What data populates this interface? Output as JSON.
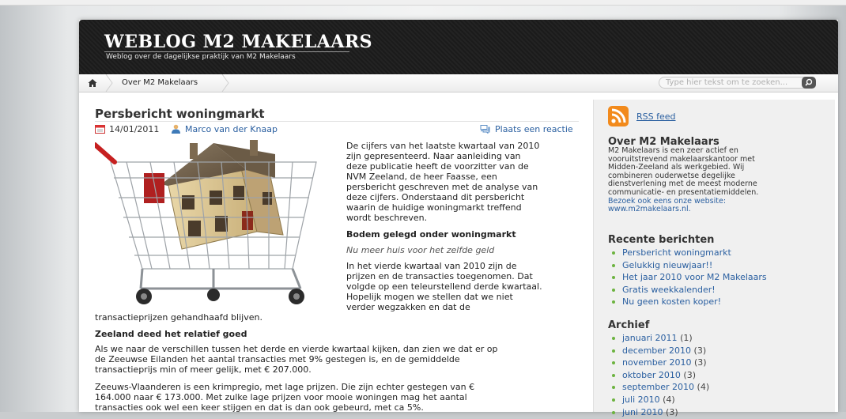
{
  "header": {
    "site_title": "WEBLOG M2 MAKELAARS",
    "site_description": "Weblog over de dagelijkse praktijk van M2 Makelaars"
  },
  "nav": {
    "items": [
      "Over M2 Makelaars"
    ],
    "search_placeholder": "Type hier tekst om te zoeken..."
  },
  "post": {
    "title": "Persbericht woningmarkt",
    "date": "14/01/2011",
    "author": "Marco van der Knaap",
    "comment_link": "Plaats een reactie",
    "intro_lines": [
      "De cijfers van het laatste kwartaal van 2010",
      "zijn gepresenteerd. Naar aanleiding van",
      "deze publicatie heeft de voorzitter van de",
      "NVM Zeeland, de heer Faasse, een",
      "persbericht geschreven met de analyse van",
      "deze cijfers. Onderstaand dit persbericht",
      "waarin de huidige woningmarkt treffend",
      "wordt beschreven."
    ],
    "subheading": "Bodem gelegd onder woningmarkt",
    "tagline": "Nu meer huis voor het zelfde geld",
    "q4_lines": [
      "In het vierde kwartaal van 2010 zijn de",
      "prijzen en de transacties toegenomen. Dat",
      "volgde op een teleurstellend derde kwartaal.",
      "Hopelijk mogen we stellen dat we niet",
      "verder wegzakken en dat de"
    ],
    "q4_tail": "transactieprijzen gehandhaafd blijven.",
    "section2_heading": "Zeeland deed het relatief goed",
    "section2_lines": [
      "Als we naar de verschillen tussen het derde en vierde kwartaal kijken, dan zien we dat er op",
      "de Zeeuwse Eilanden het aantal transacties met 9% gestegen is, en de gemiddelde",
      "transactieprijs min of meer gelijk, met € 207.000."
    ],
    "section3_lines": [
      "Zeeuws-Vlaanderen is een krimpregio, met lage prijzen. Die zijn echter gestegen van €",
      "164.000 naar € 173.000. Met zulke lage prijzen voor mooie woningen mag het aantal",
      "transacties ook wel een keer stijgen en dat is dan ook gebeurd, met ca 5%."
    ]
  },
  "sidebar": {
    "rss_label": "RSS feed",
    "about": {
      "heading": "Over M2 Makelaars",
      "lines": [
        "M2 Makelaars is een zeer actief en",
        "vooruitstrevend makelaarskantoor met",
        "Midden-Zeeland als werkgebied. Wij",
        "combineren ouderwetse degelijke",
        "dienstverlening met de meest moderne",
        "communicatie- en presentatiemiddelen."
      ],
      "link_lines": [
        "Bezoek ook eens onze website:",
        "www.m2makelaars.nl."
      ]
    },
    "recent": {
      "heading": "Recente berichten",
      "items": [
        "Persbericht woningmarkt",
        "Gelukkig nieuwjaar!!",
        "Het jaar 2010 voor M2 Makelaars",
        "Gratis weekkalender!",
        "Nu geen kosten koper!"
      ]
    },
    "archive": {
      "heading": "Archief",
      "items": [
        {
          "month": "januari 2011",
          "count": "(1)"
        },
        {
          "month": "december 2010",
          "count": "(3)"
        },
        {
          "month": "november 2010",
          "count": "(3)"
        },
        {
          "month": "oktober 2010",
          "count": "(3)"
        },
        {
          "month": "september 2010",
          "count": "(4)"
        },
        {
          "month": "juli 2010",
          "count": "(4)"
        },
        {
          "month": "juni 2010",
          "count": "(3)"
        }
      ]
    }
  },
  "colors": {
    "link": "#2a5fa0",
    "bullet": "#6cb33f",
    "header_bg": "#1b1b1b",
    "rss": "#f28a1c"
  }
}
